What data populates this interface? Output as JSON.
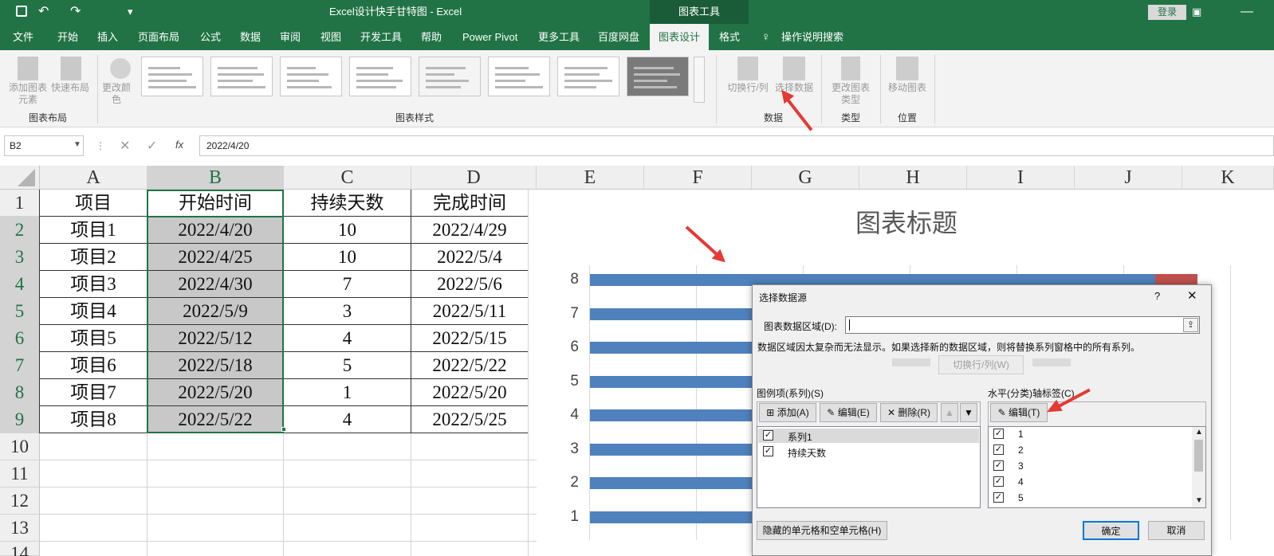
{
  "titlebar": {
    "doc_title": "Excel设计快手甘特图 - Excel",
    "context_tab": "图表工具",
    "login": "登录"
  },
  "tabs": [
    "文件",
    "开始",
    "插入",
    "页面布局",
    "公式",
    "数据",
    "审阅",
    "视图",
    "开发工具",
    "帮助",
    "Power Pivot",
    "更多工具",
    "百度网盘",
    "图表设计",
    "格式",
    "操作说明搜索"
  ],
  "ribbon": {
    "add_element": "添加图表元素",
    "quick_layout": "快速布局",
    "change_colors": "更改颜色",
    "group_layout": "图表布局",
    "group_styles": "图表样式",
    "switch_rowcol": "切换行/列",
    "select_data": "选择数据",
    "group_data": "数据",
    "change_type": "更改图表类型",
    "group_type": "类型",
    "move_chart": "移动图表",
    "group_location": "位置"
  },
  "formula": {
    "name_box": "B2",
    "value": "2022/4/20",
    "fx": "fx"
  },
  "columns": [
    "A",
    "B",
    "C",
    "D",
    "E",
    "F",
    "G",
    "H",
    "I",
    "J",
    "K"
  ],
  "rows": [
    "1",
    "2",
    "3",
    "4",
    "5",
    "6",
    "7",
    "8",
    "9",
    "10",
    "11",
    "12",
    "13",
    "14"
  ],
  "table": {
    "header": [
      "项目",
      "开始时间",
      "持续天数",
      "完成时间"
    ],
    "data": [
      [
        "项目1",
        "2022/4/20",
        "10",
        "2022/4/29"
      ],
      [
        "项目2",
        "2022/4/25",
        "10",
        "2022/5/4"
      ],
      [
        "项目3",
        "2022/4/30",
        "7",
        "2022/5/6"
      ],
      [
        "项目4",
        "2022/5/9",
        "3",
        "2022/5/11"
      ],
      [
        "项目5",
        "2022/5/12",
        "4",
        "2022/5/15"
      ],
      [
        "项目6",
        "2022/5/18",
        "5",
        "2022/5/22"
      ],
      [
        "项目7",
        "2022/5/20",
        "1",
        "2022/5/20"
      ],
      [
        "项目8",
        "2022/5/22",
        "4",
        "2022/5/25"
      ]
    ]
  },
  "chart": {
    "title": "图表标题",
    "yticks": [
      "8",
      "7",
      "6",
      "5",
      "4",
      "3",
      "2",
      "1"
    ],
    "bar_color": "#4f81bd",
    "accent_color": "#c0504d"
  },
  "dialog": {
    "title": "选择数据源",
    "help": "?",
    "close": "✕",
    "range_label": "图表数据区域(D):",
    "notice": "数据区域因太复杂而无法显示。如果选择新的数据区域，则将替换系列窗格中的所有系列。",
    "switch": "切换行/列(W)",
    "legend_label": "图例项(系列)(S)",
    "add": "添加(A)",
    "edit": "编辑(E)",
    "delete": "删除(R)",
    "series": [
      "系列1",
      "持续天数"
    ],
    "axis_label": "水平(分类)轴标签(C)",
    "axis_edit": "编辑(T)",
    "axis_items": [
      "1",
      "2",
      "3",
      "4",
      "5"
    ],
    "hidden_btn": "隐藏的单元格和空单元格(H)",
    "ok": "确定",
    "cancel": "取消"
  }
}
